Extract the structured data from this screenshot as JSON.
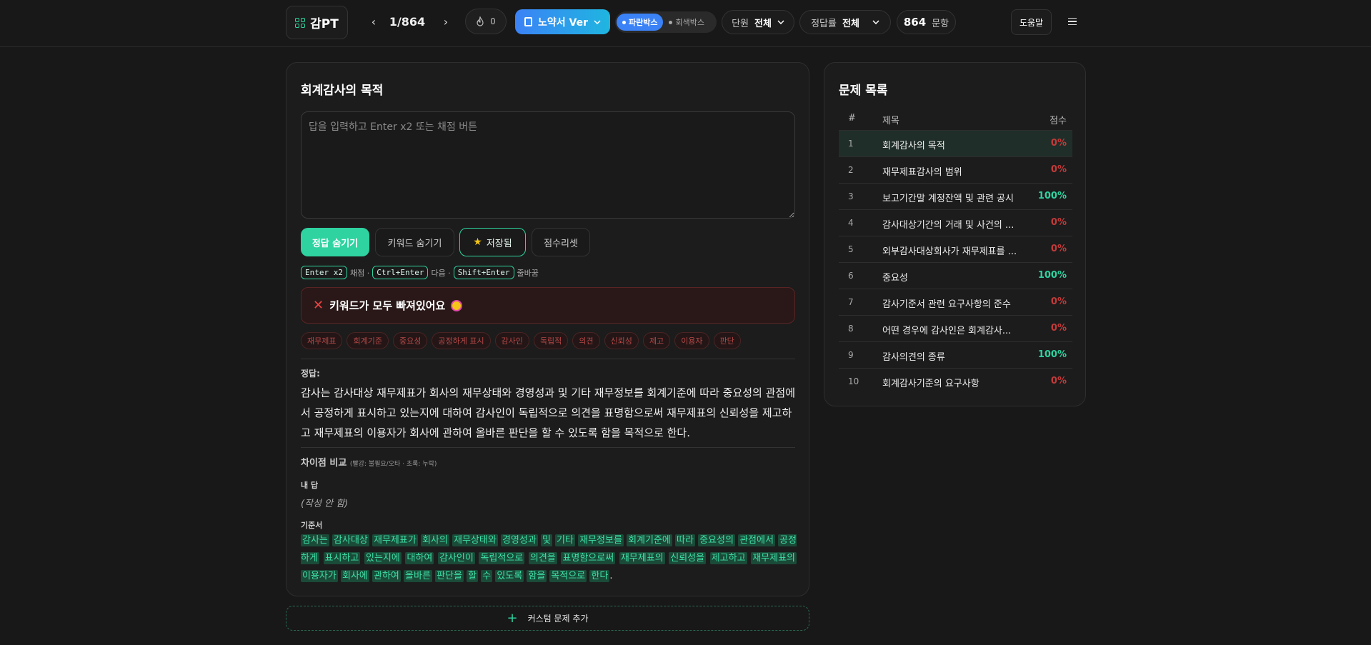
{
  "header": {
    "app_name": "감PT",
    "counter": "1/864",
    "prev_label": "‹",
    "next_label": "›",
    "fire_count": "0",
    "version_label": "노약서 Ver",
    "box_blue": "파란박스",
    "box_gray": "회색박스",
    "unit_label": "단원",
    "unit_value": "전체",
    "rate_label": "정답률",
    "rate_value": "전체",
    "count_number": "864",
    "count_suffix": "문항",
    "help_label": "도움말"
  },
  "main": {
    "title": "회계감사의 목적",
    "input_placeholder": "답을 입력하고 Enter x2 또는 채점 버튼",
    "buttons": {
      "hide_answer": "정답 숨기기",
      "hide_keywords": "키워드 숨기기",
      "saved": "저장됨",
      "reset_score": "점수리셋"
    },
    "shortcuts": {
      "k1": "Enter x2",
      "t1": "채점 ·",
      "k2": "Ctrl+Enter",
      "t2": "다음 ·",
      "k3": "Shift+Enter",
      "t3": "줄바꿈"
    },
    "alert": "키워드가 모두 빠져있어요",
    "keywords": [
      "재무제표",
      "회계기준",
      "중요성",
      "공정하게 표시",
      "감사인",
      "독립적",
      "의견",
      "신뢰성",
      "제고",
      "이용자",
      "판단"
    ],
    "answer_label": "정답:",
    "answer": "감사는 감사대상 재무제표가 회사의 재무상태와 경영성과 및 기타 재무정보를 회계기준에 따라 중요성의 관점에서 공정하게 표시하고 있는지에 대하여 감사인이 독립적으로 의견을 표명함으로써 재무제표의 신뢰성을 제고하고 재무제표의 이용자가 회사에 관하여 올바른 판단을 할 수 있도록 함을 목적으로 한다.",
    "diff_title": "차이점 비교",
    "diff_legend": "(빨강: 불필요/오타 · 초록: 누락)",
    "my_answer_label": "내 답",
    "my_answer": "(작성 안 함)",
    "standard_label": "기준서",
    "standard_words": [
      "감사는",
      "감사대상",
      "재무제표가",
      "회사의",
      "재무상태와",
      "경영성과",
      "및",
      "기타",
      "재무정보를",
      "회계기준에",
      "따라",
      "중요성의",
      "관점에서",
      "공정하게",
      "표시하고",
      "있는지에",
      "대하여",
      "감사인이",
      "독립적으로",
      "의견을",
      "표명함으로써",
      "재무제표의",
      "신뢰성을",
      "제고하고",
      "재무제표의",
      "이용자가",
      "회사에",
      "관하여",
      "올바른",
      "판단을",
      "할",
      "수",
      "있도록",
      "함을",
      "목적으로",
      "한다"
    ],
    "standard_end": ".",
    "add_custom": "커스텀 문제 추가"
  },
  "sidebar": {
    "title": "문제 목록",
    "col_num": "#",
    "col_title": "제목",
    "col_score": "점수",
    "rows": [
      {
        "n": "1",
        "title": "회계감사의 목적",
        "score": "0%"
      },
      {
        "n": "2",
        "title": "재무제표감사의 범위",
        "score": "0%"
      },
      {
        "n": "3",
        "title": "보고기간말 계정잔액 및 관련 공시",
        "score": "100%"
      },
      {
        "n": "4",
        "title": "감사대상기간의 거래 및 사건의 ...",
        "score": "0%"
      },
      {
        "n": "5",
        "title": "외부감사대상회사가 재무제표를 ...",
        "score": "0%"
      },
      {
        "n": "6",
        "title": "중요성",
        "score": "100%"
      },
      {
        "n": "7",
        "title": "감사기준서 관련 요구사항의 준수",
        "score": "0%"
      },
      {
        "n": "8",
        "title": "어떤 경우에 감사인은 회계감사...",
        "score": "0%"
      },
      {
        "n": "9",
        "title": "감사의견의 종류",
        "score": "100%"
      },
      {
        "n": "10",
        "title": "회계감사기준의 요구사항",
        "score": "0%"
      }
    ]
  }
}
